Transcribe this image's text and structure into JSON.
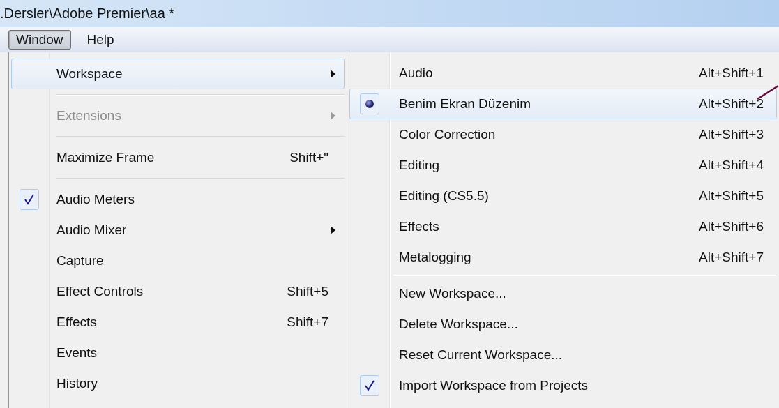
{
  "window": {
    "title": ".Dersler\\Adobe Premier\\aa *"
  },
  "menu_bar": [
    {
      "label": "Window",
      "selected": true
    },
    {
      "label": "Help",
      "selected": false
    }
  ],
  "window_menu": [
    {
      "kind": "item",
      "label": "Workspace",
      "has_submenu": true,
      "disabled": false,
      "checked": false,
      "highlighted": true
    },
    {
      "kind": "separator"
    },
    {
      "kind": "item",
      "label": "Extensions",
      "has_submenu": true,
      "disabled": true,
      "checked": false,
      "highlighted": false
    },
    {
      "kind": "separator"
    },
    {
      "kind": "item",
      "label": "Maximize Frame",
      "shortcut": "Shift+\"",
      "has_submenu": false,
      "disabled": false,
      "checked": false,
      "highlighted": false
    },
    {
      "kind": "separator"
    },
    {
      "kind": "item",
      "label": "Audio Meters",
      "has_submenu": false,
      "disabled": false,
      "checked": true,
      "highlighted": false
    },
    {
      "kind": "item",
      "label": "Audio Mixer",
      "has_submenu": true,
      "disabled": false,
      "checked": false,
      "highlighted": false
    },
    {
      "kind": "item",
      "label": "Capture",
      "has_submenu": false,
      "disabled": false,
      "checked": false,
      "highlighted": false
    },
    {
      "kind": "item",
      "label": "Effect Controls",
      "shortcut": "Shift+5",
      "has_submenu": false,
      "disabled": false,
      "checked": false,
      "highlighted": false
    },
    {
      "kind": "item",
      "label": "Effects",
      "shortcut": "Shift+7",
      "has_submenu": false,
      "disabled": false,
      "checked": false,
      "highlighted": false
    },
    {
      "kind": "item",
      "label": "Events",
      "has_submenu": false,
      "disabled": false,
      "checked": false,
      "highlighted": false
    },
    {
      "kind": "item",
      "label": "History",
      "has_submenu": false,
      "disabled": false,
      "checked": false,
      "highlighted": false
    }
  ],
  "workspace_submenu": [
    {
      "kind": "radio",
      "label": "Audio",
      "shortcut": "Alt+Shift+1",
      "selected": false,
      "highlighted": false
    },
    {
      "kind": "radio",
      "label": "Benim Ekran Düzenim",
      "shortcut": "Alt+Shift+2",
      "selected": true,
      "highlighted": true
    },
    {
      "kind": "radio",
      "label": "Color Correction",
      "shortcut": "Alt+Shift+3",
      "selected": false,
      "highlighted": false
    },
    {
      "kind": "radio",
      "label": "Editing",
      "shortcut": "Alt+Shift+4",
      "selected": false,
      "highlighted": false
    },
    {
      "kind": "radio",
      "label": "Editing (CS5.5)",
      "shortcut": "Alt+Shift+5",
      "selected": false,
      "highlighted": false
    },
    {
      "kind": "radio",
      "label": "Effects",
      "shortcut": "Alt+Shift+6",
      "selected": false,
      "highlighted": false
    },
    {
      "kind": "radio",
      "label": "Metalogging",
      "shortcut": "Alt+Shift+7",
      "selected": false,
      "highlighted": false
    },
    {
      "kind": "separator"
    },
    {
      "kind": "check",
      "label": "New Workspace...",
      "checked": false,
      "highlighted": false
    },
    {
      "kind": "check",
      "label": "Delete Workspace...",
      "checked": false,
      "highlighted": false
    },
    {
      "kind": "check",
      "label": "Reset Current Workspace...",
      "checked": false,
      "highlighted": false
    },
    {
      "kind": "check",
      "label": "Import Workspace from Projects",
      "checked": true,
      "highlighted": false
    }
  ]
}
